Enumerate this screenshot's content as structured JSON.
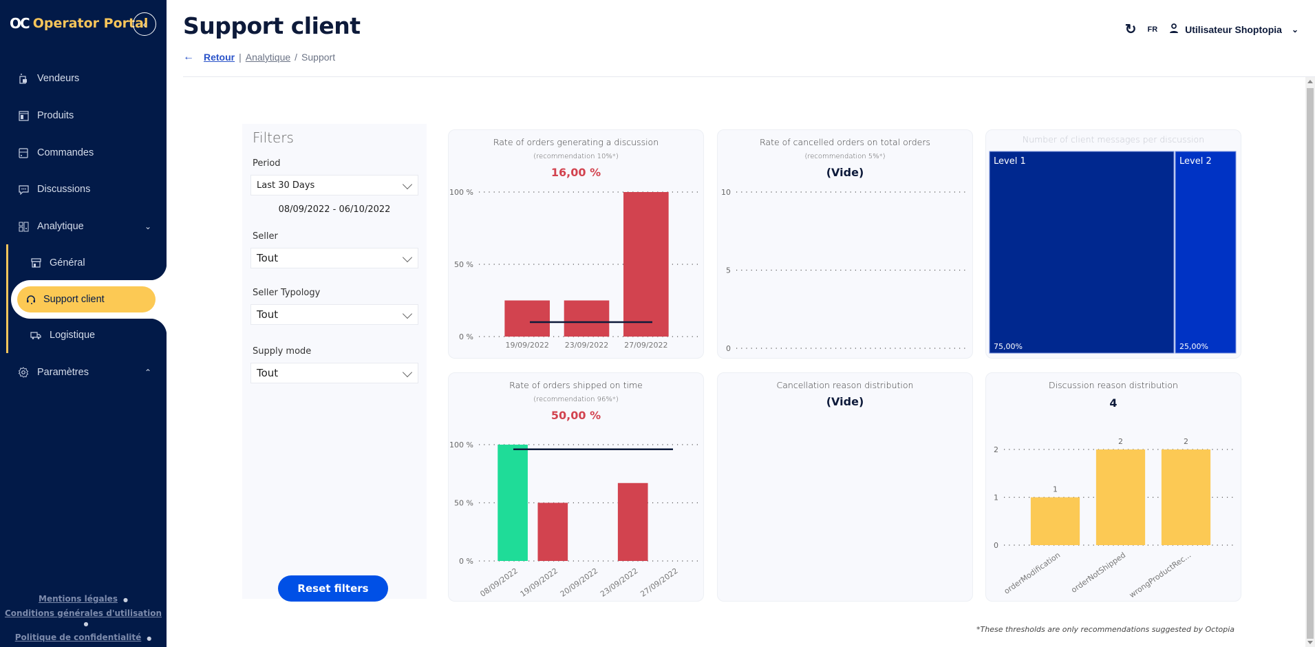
{
  "app": {
    "logo_mark": "OC",
    "title": "Operator Portal",
    "collapse_icon": "chevron-left-icon"
  },
  "sidebar": {
    "items": [
      {
        "label": "Vendeurs",
        "icon": "sellers-icon"
      },
      {
        "label": "Produits",
        "icon": "products-icon"
      },
      {
        "label": "Commandes",
        "icon": "orders-icon"
      },
      {
        "label": "Discussions",
        "icon": "chat-icon"
      },
      {
        "label": "Analytique",
        "icon": "dashboard-icon",
        "expanded": true
      },
      {
        "label": "Général",
        "icon": "store-icon"
      },
      {
        "label": "Support client",
        "icon": "headset-icon",
        "active": true
      },
      {
        "label": "Logistique",
        "icon": "truck-icon"
      },
      {
        "label": "Paramètres",
        "icon": "gear-icon",
        "expanded": false
      }
    ],
    "footer_links": [
      "Mentions légales",
      "Conditions générales d'utilisation",
      "Politique de confidentialité"
    ]
  },
  "header": {
    "title": "Support client",
    "breadcrumb": {
      "back": "Retour",
      "separator": "|",
      "parent": "Analytique",
      "slash": "/",
      "current": "Support"
    },
    "lang": "FR",
    "user": "Utilisateur Shoptopia"
  },
  "filters": {
    "title": "Filters",
    "period_label": "Period",
    "period_value": "Last 30 Days",
    "date_range": "08/09/2022 - 06/10/2022",
    "seller_label": "Seller",
    "seller_value": "Tout",
    "typology_label": "Seller Typology",
    "typology_value": "Tout",
    "supply_label": "Supply mode",
    "supply_value": "Tout",
    "reset_label": "Reset filters"
  },
  "footnote": "*These thresholds are only recommendations suggested by Octopia",
  "colors": {
    "sidebar_bg": "#021a48",
    "accent_yellow": "#fcc954",
    "primary_blue": "#0050e6",
    "bar_red": "#d2434f",
    "bar_green": "#1fdc98",
    "treemap_dark": "#00288f",
    "treemap_light": "#0033c4"
  },
  "chart_data": [
    {
      "id": "discussion_rate",
      "type": "bar",
      "title": "Rate of orders generating a discussion",
      "subtitle": "(recommendation 10%*)",
      "kpi": "16,00 %",
      "categories": [
        "19/09/2022",
        "23/09/2022",
        "27/09/2022"
      ],
      "values": [
        25,
        25,
        100
      ],
      "bar_colors": [
        "#d2434f",
        "#d2434f",
        "#d2434f"
      ],
      "target_line": 10,
      "yticks": [
        "0 %",
        "50 %",
        "100 %"
      ],
      "ylim": [
        0,
        100
      ],
      "grid": true
    },
    {
      "id": "cancelled_rate",
      "type": "bar",
      "title": "Rate of cancelled orders on total orders",
      "subtitle": "(recommendation 5%*)",
      "kpi": "(Vide)",
      "categories": [],
      "values": [],
      "yticks": [
        "0",
        "5",
        "10"
      ],
      "ylim": [
        0,
        10
      ],
      "grid": true
    },
    {
      "id": "messages_per_discussion",
      "type": "treemap",
      "title": "Number of client messages per discussion",
      "categories": [
        "Level 1",
        "Level 2"
      ],
      "values": [
        75,
        25
      ],
      "labels": [
        "75,00%",
        "25,00%"
      ]
    },
    {
      "id": "shipped_on_time",
      "type": "bar",
      "title": "Rate of orders shipped on time",
      "subtitle": "(recommendation 96%*)",
      "kpi": "50,00 %",
      "categories": [
        "08/09/2022",
        "19/09/2022",
        "20/09/2022",
        "23/09/2022",
        "27/09/2022"
      ],
      "values": [
        100,
        50,
        0,
        67,
        0
      ],
      "bar_colors": [
        "#1fdc98",
        "#d2434f",
        "#d2434f",
        "#d2434f",
        "#d2434f"
      ],
      "target_line": 96,
      "yticks": [
        "0 %",
        "50 %",
        "100 %"
      ],
      "ylim": [
        0,
        100
      ],
      "grid": true
    },
    {
      "id": "cancellation_reasons",
      "type": "bar",
      "title": "Cancellation reason distribution",
      "kpi": "(Vide)",
      "categories": [],
      "values": []
    },
    {
      "id": "discussion_reasons",
      "type": "bar",
      "title": "Discussion reason distribution",
      "kpi": "4",
      "categories": [
        "orderModification",
        "orderNotShipped",
        "wrongProductRec..."
      ],
      "values": [
        1,
        2,
        2
      ],
      "bar_colors": [
        "#fcc954",
        "#fcc954",
        "#fcc954"
      ],
      "data_labels": [
        "1",
        "2",
        "2"
      ],
      "yticks": [
        "0",
        "1",
        "2"
      ],
      "ylim": [
        0,
        2
      ],
      "grid": true
    }
  ]
}
